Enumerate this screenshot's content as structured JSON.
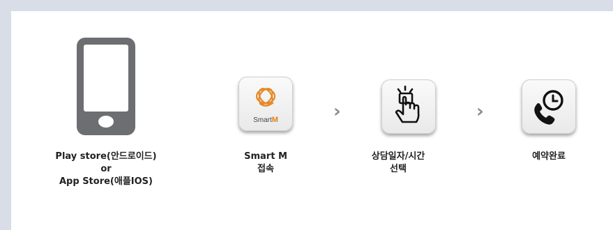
{
  "steps": [
    {
      "caption_lines": [
        "Play store(안드로이드)",
        "or",
        "App Store(애플IOS)"
      ],
      "icon": "smartphone-icon"
    },
    {
      "caption_lines": [
        "Smart M",
        "접속"
      ],
      "icon": "smart-m-app-icon",
      "icon_label_prefix": "Smart",
      "icon_label_suffix": "M"
    },
    {
      "caption_lines": [
        "상담일자/시간",
        "선택"
      ],
      "icon": "touch-hand-icon"
    },
    {
      "caption_lines": [
        "예약완료"
      ],
      "icon": "phone-clock-icon"
    }
  ],
  "separator": "›",
  "colors": {
    "border": "#d9dde7",
    "phone": "#6d6e71",
    "accent": "#e07f1c",
    "arrow": "#8a8a8a"
  }
}
